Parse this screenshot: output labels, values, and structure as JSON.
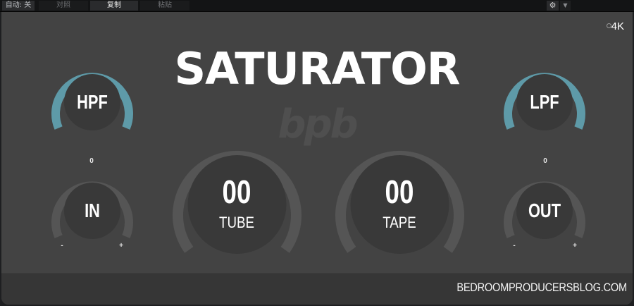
{
  "host_toolbar": {
    "auto_label": "自动: 关",
    "compare_label": "对照",
    "copy_label": "复制",
    "paste_label": "粘贴",
    "settings_icon": "gear-icon",
    "menu_icon": "dropdown-arrow-icon"
  },
  "plugin": {
    "title": "SATURATOR",
    "logo_text": "bpb",
    "quality_toggle_label": "4K",
    "footer_url": "BEDROOMPRODUCERSBLOG.COM"
  },
  "knobs": {
    "hpf": {
      "label": "HPF",
      "accent": "#5e9aa8"
    },
    "lpf": {
      "label": "LPF",
      "accent": "#5e9aa8"
    },
    "input": {
      "label": "IN",
      "center_value": "0",
      "min_label": "-",
      "max_label": "+"
    },
    "output": {
      "label": "OUT",
      "center_value": "0",
      "min_label": "-",
      "max_label": "+"
    },
    "tube": {
      "value": "00",
      "label": "TUBE"
    },
    "tape": {
      "value": "00",
      "label": "TAPE"
    }
  },
  "colors": {
    "panel": "#434343",
    "knob_body": "#393939",
    "knob_track": "#555555",
    "accent": "#5e9aa8"
  }
}
